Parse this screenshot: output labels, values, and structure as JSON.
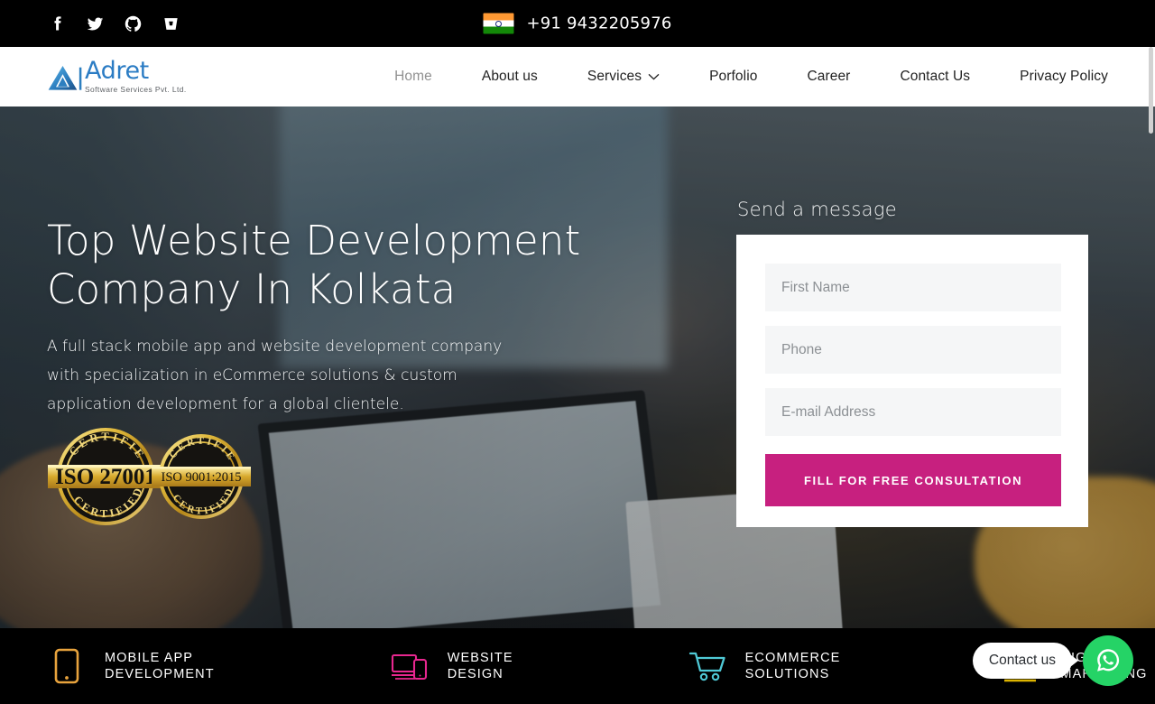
{
  "topbar": {
    "social": [
      {
        "name": "facebook-icon",
        "label": "Facebook"
      },
      {
        "name": "twitter-icon",
        "label": "Twitter"
      },
      {
        "name": "github-icon",
        "label": "GitHub"
      },
      {
        "name": "bitbucket-icon",
        "label": "Bitbucket"
      }
    ],
    "flag_alt": "India",
    "phone": "+91 9432205976",
    "bg_color": "#000000"
  },
  "header": {
    "logo": {
      "word": "Adret",
      "tagline": "Software Services Pvt. Ltd.",
      "mark_color": "#2b7cc4"
    },
    "nav": [
      {
        "label": "Home",
        "active": true,
        "has_dropdown": false
      },
      {
        "label": "About us",
        "active": false,
        "has_dropdown": false
      },
      {
        "label": "Services",
        "active": false,
        "has_dropdown": true
      },
      {
        "label": "Porfolio",
        "active": false,
        "has_dropdown": false
      },
      {
        "label": "Career",
        "active": false,
        "has_dropdown": false
      },
      {
        "label": "Contact Us",
        "active": false,
        "has_dropdown": false
      },
      {
        "label": "Privacy Policy",
        "active": false,
        "has_dropdown": false
      }
    ]
  },
  "hero": {
    "title": "Top Website Development Company In Kolkata",
    "subtitle": "A full stack mobile app and website development company with specialization in eCommerce solutions & custom application development for a global clientele.",
    "badges": [
      {
        "name": "iso-27001-badge",
        "top_text": "CERTIFIED",
        "main_text": "ISO 27001",
        "bottom_text": "CERTIFIED"
      },
      {
        "name": "iso-9001-badge",
        "top_text": "CERTIFIED",
        "main_text": "ISO 9001:2015",
        "bottom_text": "CERTIFIED"
      }
    ]
  },
  "form": {
    "heading": "Send a message",
    "fields": [
      {
        "name": "first-name-input",
        "placeholder": "First Name",
        "value": ""
      },
      {
        "name": "phone-input",
        "placeholder": "Phone",
        "value": ""
      },
      {
        "name": "email-input",
        "placeholder": "E-mail Address",
        "value": ""
      }
    ],
    "submit_label": "FILL FOR FREE CONSULTATION",
    "submit_color": "#C7207F"
  },
  "services": [
    {
      "name": "mobile-app-development",
      "line1": "MOBILE APP",
      "line2": "DEVELOPMENT",
      "icon": "mobile-phone-icon",
      "color": "#E8A33D"
    },
    {
      "name": "website-design",
      "line1": "WEBSITE",
      "line2": "DESIGN",
      "icon": "laptop-mobile-icon",
      "color": "#E8278F"
    },
    {
      "name": "ecommerce-solutions",
      "line1": "ECOMMERCE",
      "line2": "SOLUTIONS",
      "icon": "shopping-cart-icon",
      "color": "#4FC9D6"
    },
    {
      "name": "digital-marketing",
      "line1": "DIGITAL",
      "line2": "MARKETING",
      "icon": "bar-chart-icon",
      "color": "#F2C500"
    }
  ],
  "whatsapp": {
    "bubble_label": "Contact us",
    "icon": "whatsapp-icon",
    "color": "#25D366"
  }
}
